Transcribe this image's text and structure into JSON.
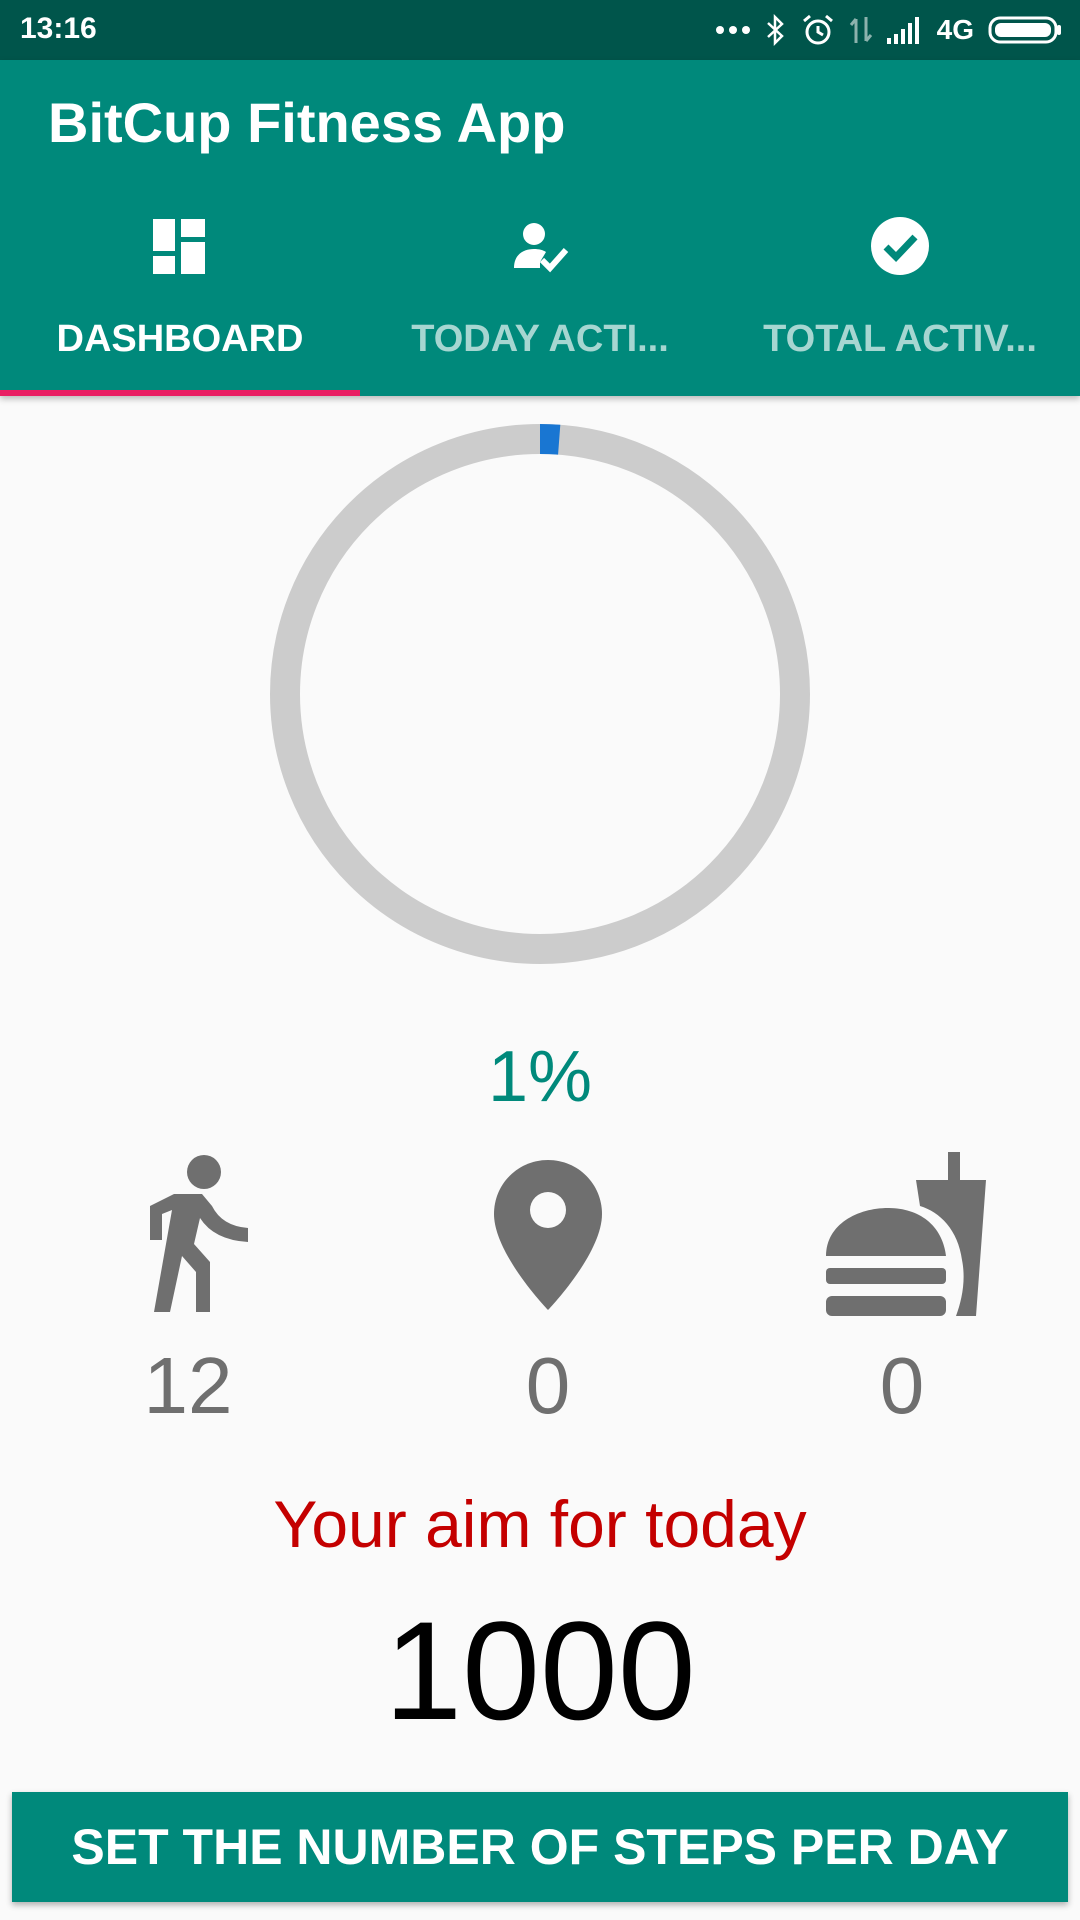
{
  "status_bar": {
    "time": "13:16",
    "network": "4G",
    "icons": [
      "more-dots-icon",
      "bluetooth-icon",
      "alarm-icon",
      "data-arrows-icon",
      "signal-icon",
      "battery-icon"
    ]
  },
  "app_bar": {
    "title": "BitCup Fitness App",
    "tabs": [
      {
        "label": "DASHBOARD",
        "icon": "dashboard-icon",
        "active": true
      },
      {
        "label": "TODAY ACTI...",
        "icon": "person-check-icon",
        "active": false
      },
      {
        "label": "TOTAL ACTIV...",
        "icon": "check-circle-icon",
        "active": false
      }
    ]
  },
  "progress": {
    "percent_label": "1%",
    "fraction": 0.012
  },
  "stats": [
    {
      "icon": "walk-icon",
      "value": "12"
    },
    {
      "icon": "location-pin-icon",
      "value": "0"
    },
    {
      "icon": "fastfood-icon",
      "value": "0"
    }
  ],
  "aim": {
    "label": "Your aim for today",
    "value": "1000"
  },
  "button": {
    "label": "SET THE NUMBER OF STEPS PER DAY"
  },
  "colors": {
    "status_bar": "#00554b",
    "primary": "#00897b",
    "tab_indicator": "#e91e63",
    "ring_track": "#cccccc",
    "ring_progress": "#1976d2",
    "aim_label": "#c40000",
    "stat_icon": "#6f6f6f"
  }
}
